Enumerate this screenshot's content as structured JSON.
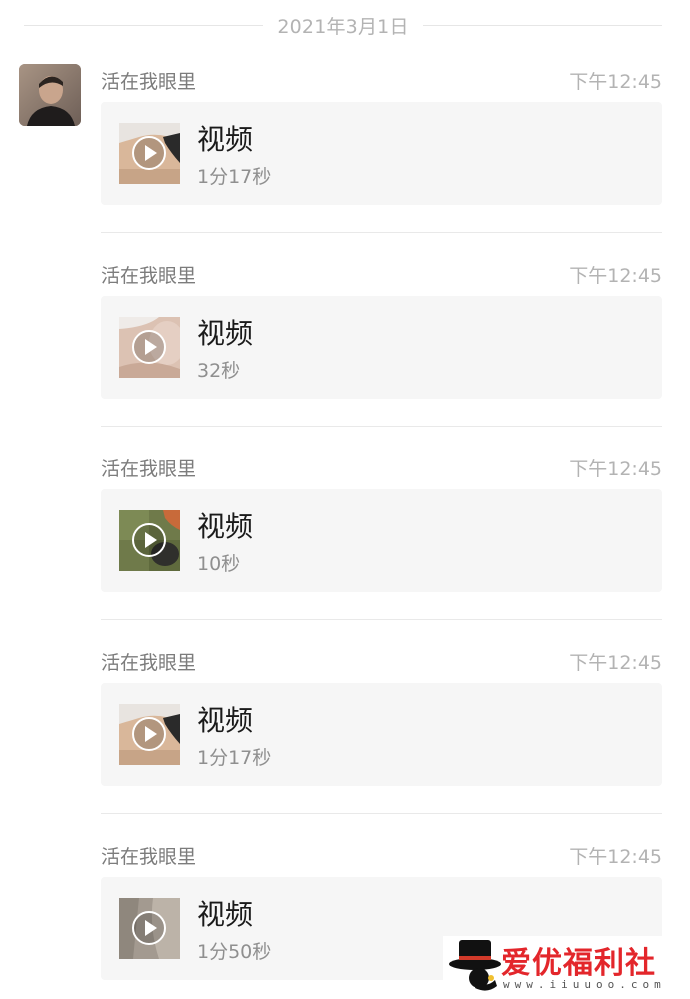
{
  "date_separator": "2021年3月1日",
  "messages": [
    {
      "sender": "活在我眼里",
      "time": "下午12:45",
      "title": "视频",
      "duration": "1分17秒"
    },
    {
      "sender": "活在我眼里",
      "time": "下午12:45",
      "title": "视频",
      "duration": "32秒"
    },
    {
      "sender": "活在我眼里",
      "time": "下午12:45",
      "title": "视频",
      "duration": "10秒"
    },
    {
      "sender": "活在我眼里",
      "time": "下午12:45",
      "title": "视频",
      "duration": "1分17秒"
    },
    {
      "sender": "活在我眼里",
      "time": "下午12:45",
      "title": "视频",
      "duration": "1分50秒"
    }
  ],
  "watermark": {
    "text": "爱优福利社",
    "url": "www.iiuuoo.com"
  },
  "icons": {
    "play": "play-icon",
    "avatar": "avatar",
    "logo": "top-hat-logo-icon"
  }
}
